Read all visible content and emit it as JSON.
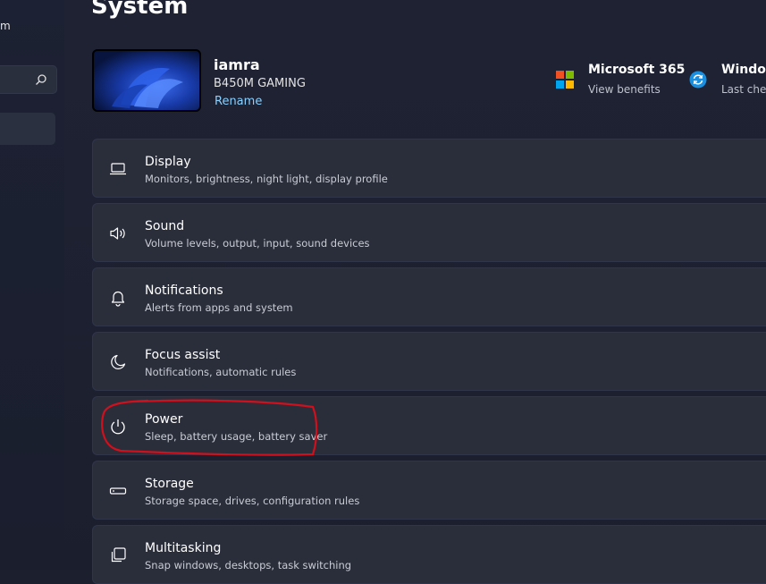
{
  "sidebar": {
    "fragment": "m",
    "search": {
      "placeholder": ""
    }
  },
  "header": {
    "title": "System"
  },
  "device": {
    "name": "iamra",
    "model": "B450M GAMING",
    "rename": "Rename"
  },
  "promos": [
    {
      "title": "Microsoft 365",
      "subtitle": "View benefits",
      "icon": "microsoft-logo"
    },
    {
      "title": "Window",
      "subtitle": "Last chec",
      "icon": "windows-update-icon"
    }
  ],
  "settings": [
    {
      "title": "Display",
      "subtitle": "Monitors, brightness, night light, display profile",
      "icon": "display-icon"
    },
    {
      "title": "Sound",
      "subtitle": "Volume levels, output, input, sound devices",
      "icon": "speaker-icon"
    },
    {
      "title": "Notifications",
      "subtitle": "Alerts from apps and system",
      "icon": "bell-icon"
    },
    {
      "title": "Focus assist",
      "subtitle": "Notifications, automatic rules",
      "icon": "moon-icon"
    },
    {
      "title": "Power",
      "subtitle": "Sleep, battery usage, battery saver",
      "icon": "power-icon"
    },
    {
      "title": "Storage",
      "subtitle": "Storage space, drives, configuration rules",
      "icon": "storage-icon"
    },
    {
      "title": "Multitasking",
      "subtitle": "Snap windows, desktops, task switching",
      "icon": "multitasking-icon"
    }
  ],
  "colors": {
    "accent_link": "#8ad0ff",
    "annotation": "#d0101c",
    "card": "#2a2e3b"
  }
}
